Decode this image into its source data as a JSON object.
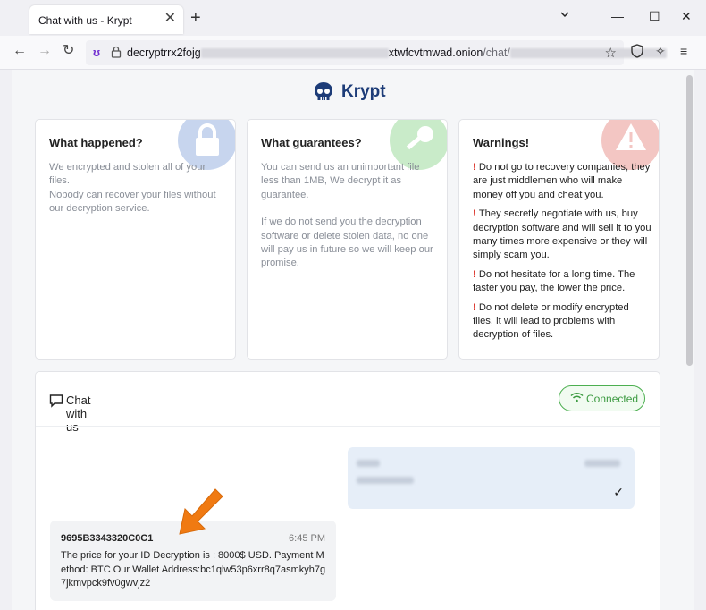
{
  "browser": {
    "tab_title": "Chat with us - Krypt",
    "url_prefix": "decryptrrx2fojg",
    "url_middle": "xtwfcvtmwad.onion",
    "url_path": "/chat/"
  },
  "brand": {
    "name": "Krypt",
    "icon": "skull-icon"
  },
  "cards": [
    {
      "title": "What happened?",
      "icon": "lock-icon",
      "accent": "#8aa6d8",
      "paragraphs": [
        "We encrypted and stolen all of your files.\nNobody can recover your files without our decryption service."
      ]
    },
    {
      "title": "What guarantees?",
      "icon": "key-icon",
      "accent": "#8fd18f",
      "paragraphs": [
        "You can send us an unimportant file less than 1MB, We decrypt it as guarantee.",
        "If we do not send you the decryption software or delete stolen data, no one will pay us in future so we will keep our promise."
      ]
    },
    {
      "title": "Warnings!",
      "icon": "warning-icon",
      "accent": "#e88a84",
      "items": [
        "Do not go to recovery companies, they are just middlemen who will make money off you and cheat you.",
        "They secretly negotiate with us, buy decryption software and will sell it to you many times more expensive or they will simply scam you.",
        "Do not hesitate for a long time. The faster you pay, the lower the price.",
        "Do not delete or modify encrypted files, it will lead to problems with decryption of files."
      ]
    }
  ],
  "chat": {
    "title": "Chat with us",
    "status": "Connected",
    "status_color": "#3d9b42",
    "incoming": {
      "id": "9695B3343320C0C1",
      "time": "6:45 PM",
      "text": "The price for your ID Decryption is : 8000$ USD. Payment Method: BTC Our Wallet Address:bc1qlw53p6xrr8q7asmkyh7g7jkmvpck9fv0gwvjz2"
    }
  },
  "colors": {
    "brand": "#1d3c78",
    "alert": "#d9261c",
    "arrow": "#f07a12"
  }
}
